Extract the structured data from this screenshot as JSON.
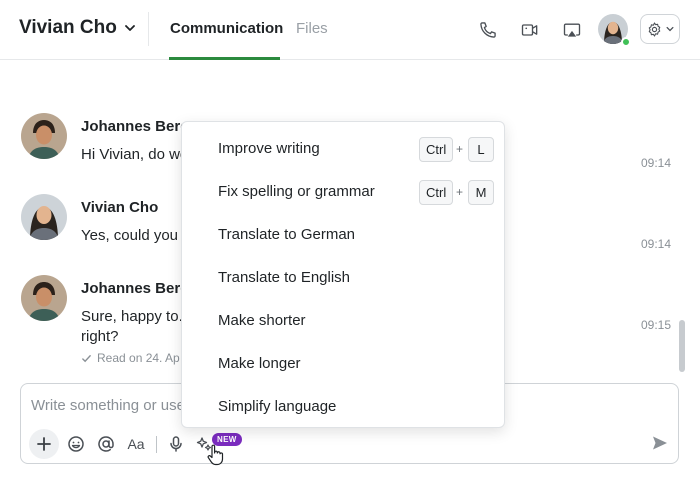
{
  "header": {
    "chat_title": "Vivian Cho",
    "tabs": [
      {
        "label": "Communication",
        "active": true
      },
      {
        "label": "Files",
        "active": false
      }
    ],
    "presence_color": "#40c057"
  },
  "messages": [
    {
      "author": "Johannes Berg",
      "text": "Hi Vivian, do we",
      "time": "09:14"
    },
    {
      "author": "Vivian Cho",
      "text": "Yes, could you c",
      "time": "09:14"
    },
    {
      "author": "Johannes Berg",
      "text_line1": "Sure, happy to.",
      "text_line2": "right?",
      "time": "09:15",
      "read_info": "Read on 24. Ap"
    }
  ],
  "composer": {
    "placeholder": "Write something or use",
    "text_format_label": "Aa",
    "new_badge": "NEW"
  },
  "ai_menu": {
    "items": [
      {
        "label": "Improve writing",
        "shortcut": [
          "Ctrl",
          "L"
        ]
      },
      {
        "label": "Fix spelling or grammar",
        "shortcut": [
          "Ctrl",
          "M"
        ]
      },
      {
        "label": "Translate to German"
      },
      {
        "label": "Translate to English"
      },
      {
        "label": "Make shorter"
      },
      {
        "label": "Make longer"
      },
      {
        "label": "Simplify language"
      }
    ],
    "plus": "+"
  },
  "colors": {
    "accent": "#2b8a3e",
    "badge": "#7b2cbf"
  }
}
